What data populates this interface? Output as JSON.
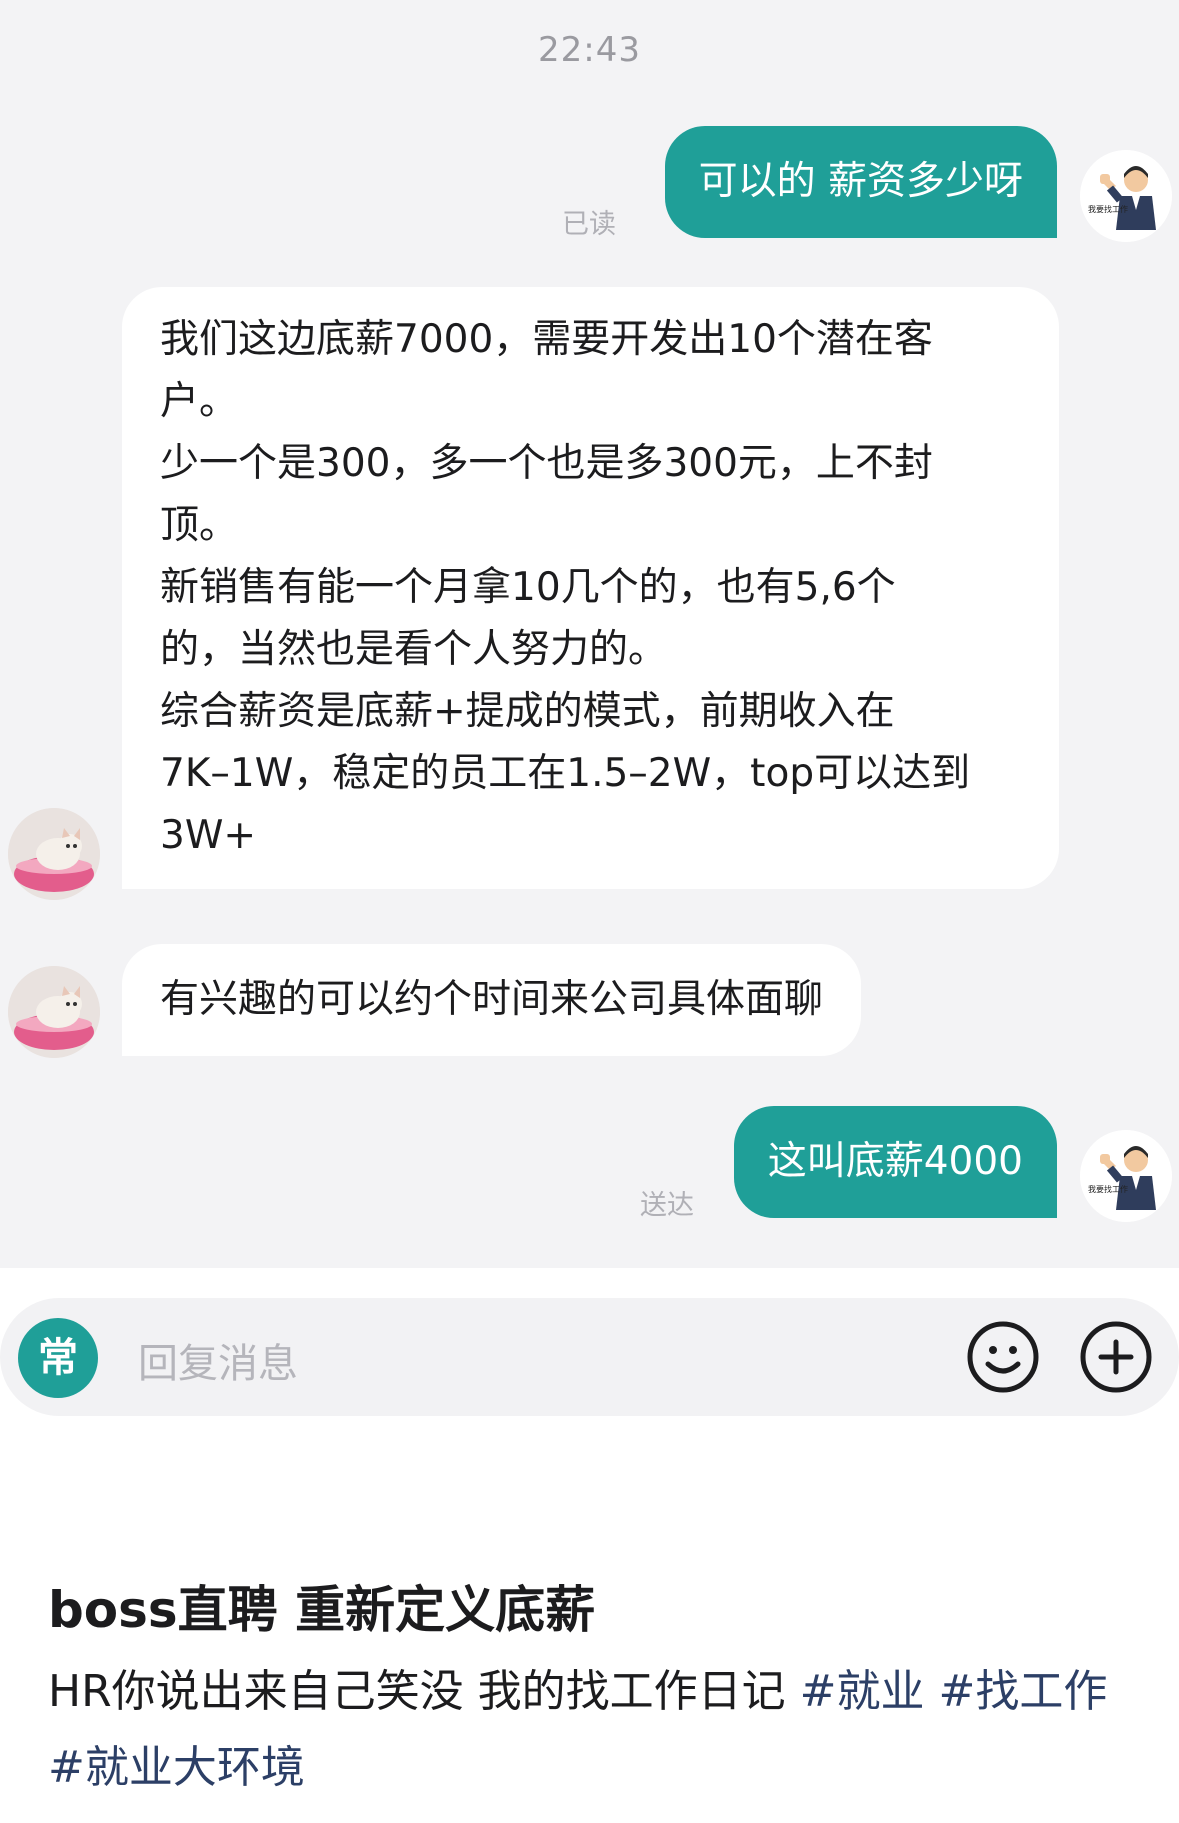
{
  "chat": {
    "time": "22:43",
    "messages": [
      {
        "text": "可以的 薪资多少呀",
        "status": "已读"
      },
      {
        "lines": [
          "我们这边底薪7000，需要开发出10个潜在客",
          "户。",
          "少一个是300，多一个也是多300元，上不封",
          "顶。",
          "新销售有能一个月拿10几个的，也有5,6个",
          "的，当然也是看个人努力的。",
          "综合薪资是底薪+提成的模式，前期收入在",
          "7K–1W，稳定的员工在1.5–2W，top可以达到",
          "3W+"
        ]
      },
      {
        "text": "有兴趣的可以约个时间来公司具体面聊"
      },
      {
        "text": "这叫底薪4000",
        "status": "送达"
      }
    ],
    "avatar_caption": "我要找工作"
  },
  "input": {
    "quick_label": "常",
    "placeholder": "回复消息",
    "emoji_icon": "smiley-icon",
    "add_icon": "plus-circle-icon"
  },
  "post": {
    "title": "boss直聘 重新定义底薪",
    "body": "HR你说出来自己笑没 我的找工作日记 ",
    "tags": [
      "#就业",
      "#找工作",
      "#就业大环境"
    ]
  },
  "colors": {
    "accent": "#1f9f98",
    "chat_bg": "#f3f3f5",
    "hashtag": "#2c3f66"
  }
}
